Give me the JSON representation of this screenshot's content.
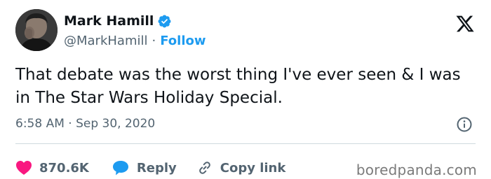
{
  "author": {
    "name": "Mark Hamill",
    "handle": "@MarkHamill",
    "separator": "·",
    "follow_label": "Follow",
    "verified": true
  },
  "tweet": {
    "text": "That debate was the worst thing I've ever seen & I was in The Star Wars Holiday Special.",
    "timestamp": "6:58 AM · Sep 30, 2020"
  },
  "actions": {
    "likes_count": "870.6K",
    "reply_label": "Reply",
    "copy_link_label": "Copy link"
  },
  "icons": {
    "logo": "x-logo-icon",
    "verified": "verified-badge-icon",
    "info": "info-icon",
    "like": "heart-icon",
    "reply": "reply-bubble-icon",
    "link": "link-icon"
  },
  "colors": {
    "text": "#0f1419",
    "secondary": "#536471",
    "accent": "#1d9bf0",
    "like": "#f91880",
    "divider": "#cfd9de"
  },
  "watermark": "boredpanda.com"
}
